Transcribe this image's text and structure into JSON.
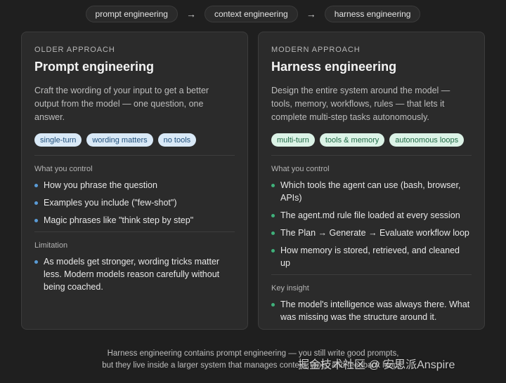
{
  "flow": {
    "steps": [
      "prompt engineering",
      "context engineering",
      "harness engineering"
    ],
    "arrow_glyph": "→"
  },
  "left": {
    "eyebrow": "OLDER APPROACH",
    "title": "Prompt engineering",
    "description": "Craft the wording of your input to get a better output from the model — one question, one answer.",
    "tags": [
      "single-turn",
      "wording matters",
      "no tools"
    ],
    "section1_label": "What you control",
    "section1_items": [
      "How you phrase the question",
      "Examples you include (\"few-shot\")",
      "Magic phrases like \"think step by step\""
    ],
    "section2_label": "Limitation",
    "section2_items": [
      "As models get stronger, wording tricks matter less. Modern models reason carefully without being coached."
    ],
    "accent": "#5a9bd6"
  },
  "right": {
    "eyebrow": "MODERN APPROACH",
    "title": "Harness engineering",
    "description": "Design the entire system around the model — tools, memory, workflows, rules — that lets it complete multi-step tasks autonomously.",
    "tags": [
      "multi-turn",
      "tools & memory",
      "autonomous loops"
    ],
    "section1_label": "What you control",
    "section1_items": [
      "Which tools the agent can use (bash, browser, APIs)",
      "The agent.md rule file loaded at every session",
      "The Plan → Generate → Evaluate workflow loop",
      "How memory is stored, retrieved, and cleaned up"
    ],
    "section2_label": "Key insight",
    "section2_items": [
      "The model's intelligence was always there. What was missing was the structure around it."
    ],
    "accent": "#3fb07a"
  },
  "footer": {
    "line1": "Harness engineering contains prompt engineering — you still write good prompts,",
    "line2": "but they live inside a larger system that manages context, tools, and feedback loops."
  },
  "watermark": "掘金技术社区 @ 安思派Anspire"
}
